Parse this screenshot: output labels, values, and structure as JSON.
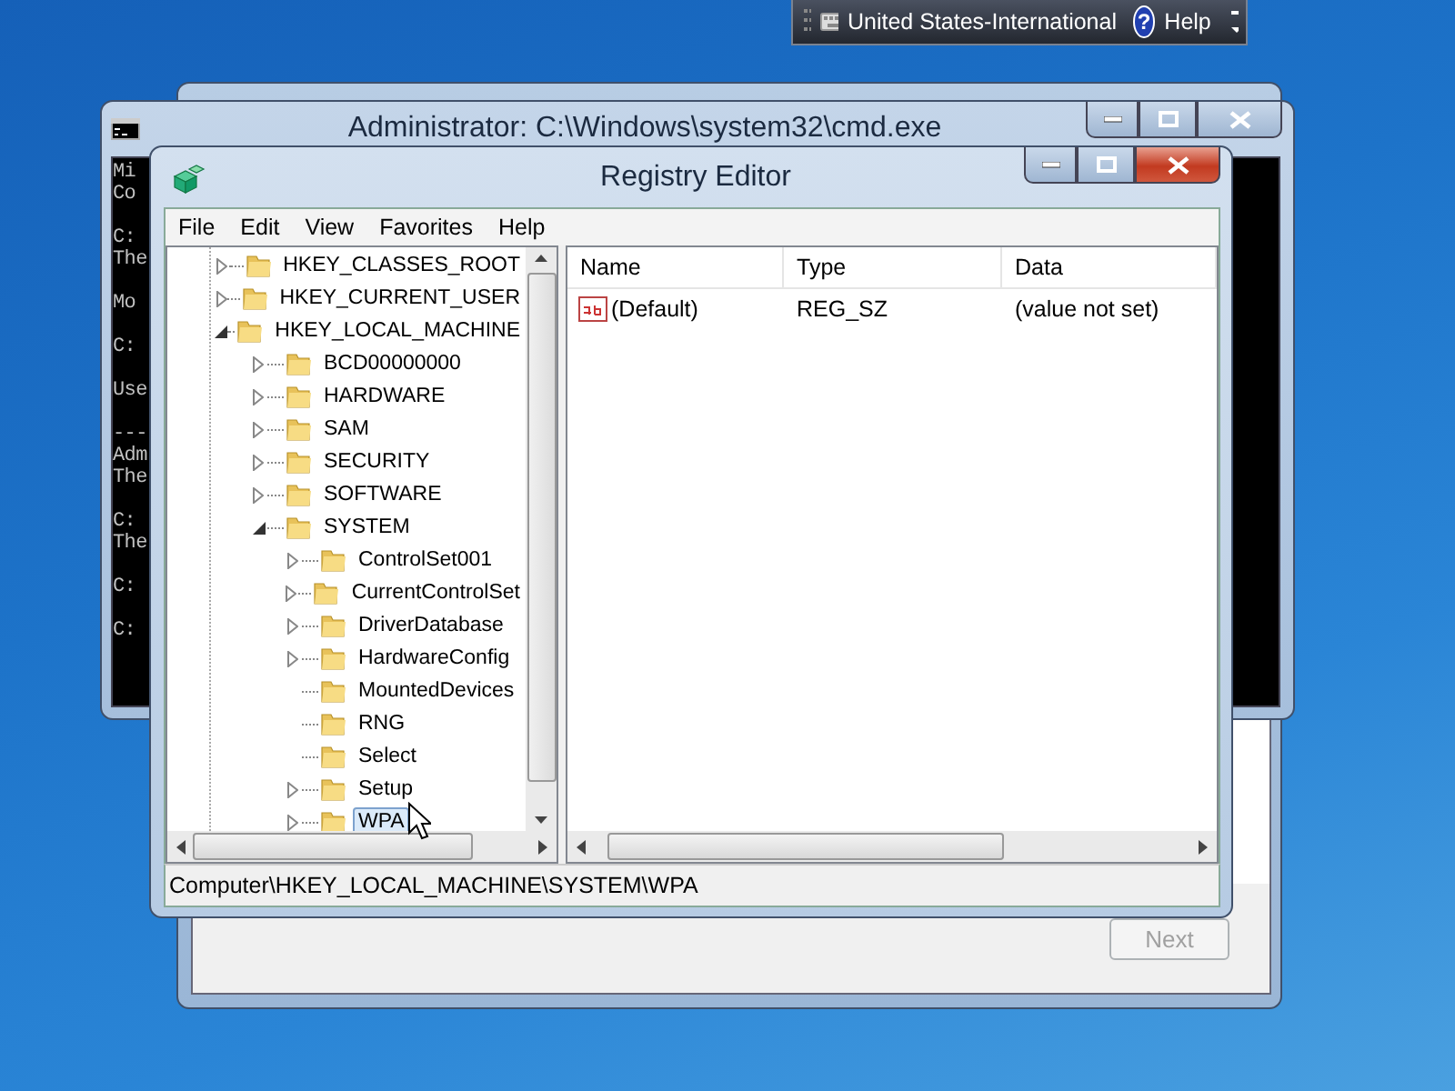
{
  "language_bar": {
    "language": "United States-International",
    "help_icon": "?",
    "help": "Help"
  },
  "setup_window": {
    "next_button": {
      "label": "Next",
      "disabled": true
    }
  },
  "cmd_window": {
    "title": "Administrator: C:\\Windows\\system32\\cmd.exe",
    "console_blocks": [
      [
        "Mi",
        "Co"
      ],
      [
        "C:",
        "The"
      ],
      [
        "Mo"
      ],
      [
        "C:"
      ],
      [
        "Use"
      ],
      [
        "---",
        "Adm",
        "The"
      ],
      [
        "C:",
        "The"
      ],
      [
        "C:"
      ],
      [
        "C:"
      ]
    ]
  },
  "registry_editor": {
    "title": "Registry Editor",
    "menu": [
      "File",
      "Edit",
      "View",
      "Favorites",
      "Help"
    ],
    "tree": [
      {
        "label": "HKEY_CLASSES_ROOT",
        "expanded": false,
        "selected": false
      },
      {
        "label": "HKEY_CURRENT_USER",
        "expanded": false,
        "selected": false
      },
      {
        "label": "HKEY_LOCAL_MACHINE",
        "expanded": true,
        "selected": false,
        "children": [
          {
            "label": "BCD00000000",
            "expanded": false,
            "selected": false
          },
          {
            "label": "HARDWARE",
            "expanded": false,
            "selected": false
          },
          {
            "label": "SAM",
            "expanded": false,
            "selected": false
          },
          {
            "label": "SECURITY",
            "expanded": false,
            "selected": false
          },
          {
            "label": "SOFTWARE",
            "expanded": false,
            "selected": false
          },
          {
            "label": "SYSTEM",
            "expanded": true,
            "selected": false,
            "children": [
              {
                "label": "ControlSet001",
                "expanded": false,
                "selected": false
              },
              {
                "label": "CurrentControlSet",
                "expanded": false,
                "selected": false
              },
              {
                "label": "DriverDatabase",
                "expanded": false,
                "selected": false
              },
              {
                "label": "HardwareConfig",
                "expanded": false,
                "selected": false
              },
              {
                "label": "MountedDevices",
                "selected": false
              },
              {
                "label": "RNG",
                "selected": false
              },
              {
                "label": "Select",
                "selected": false
              },
              {
                "label": "Setup",
                "expanded": false,
                "selected": false
              },
              {
                "label": "WPA",
                "expanded": false,
                "selected": true
              }
            ]
          }
        ]
      }
    ],
    "columns": [
      "Name",
      "Type",
      "Data"
    ],
    "values": [
      {
        "name": "(Default)",
        "type": "REG_SZ",
        "data": "(value not set)"
      }
    ],
    "status_bar": "Computer\\HKEY_LOCAL_MACHINE\\SYSTEM\\WPA"
  }
}
